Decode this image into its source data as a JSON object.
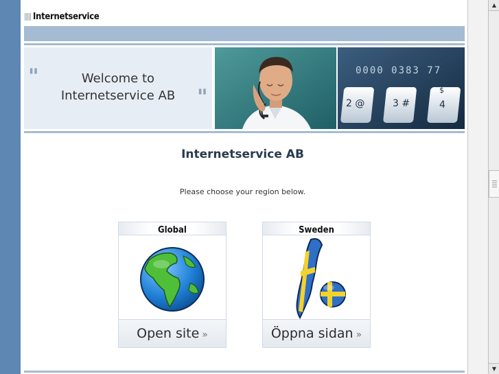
{
  "header": {
    "logo_text": "Internetservice"
  },
  "banner": {
    "welcome_line1": "Welcome to",
    "welcome_line2": "Internetservice AB",
    "quote_open": "\"",
    "quote_close": "\""
  },
  "main": {
    "title": "Internetservice AB",
    "instruction": "Please choose your region below.",
    "regions": [
      {
        "name": "Global",
        "button_label": "Open site",
        "icon": "globe-icon"
      },
      {
        "name": "Sweden",
        "button_label": "Öppna sidan",
        "icon": "sweden-map-icon"
      }
    ],
    "chevron": "»"
  },
  "scrollbar": {
    "up_arrow": "▲",
    "down_arrow": "▼"
  },
  "colors": {
    "sidebar": "#5e87b3",
    "nav_bar": "#a4bbd3",
    "welcome_bg": "#e7edf4",
    "title_text": "#2a3a4d"
  }
}
